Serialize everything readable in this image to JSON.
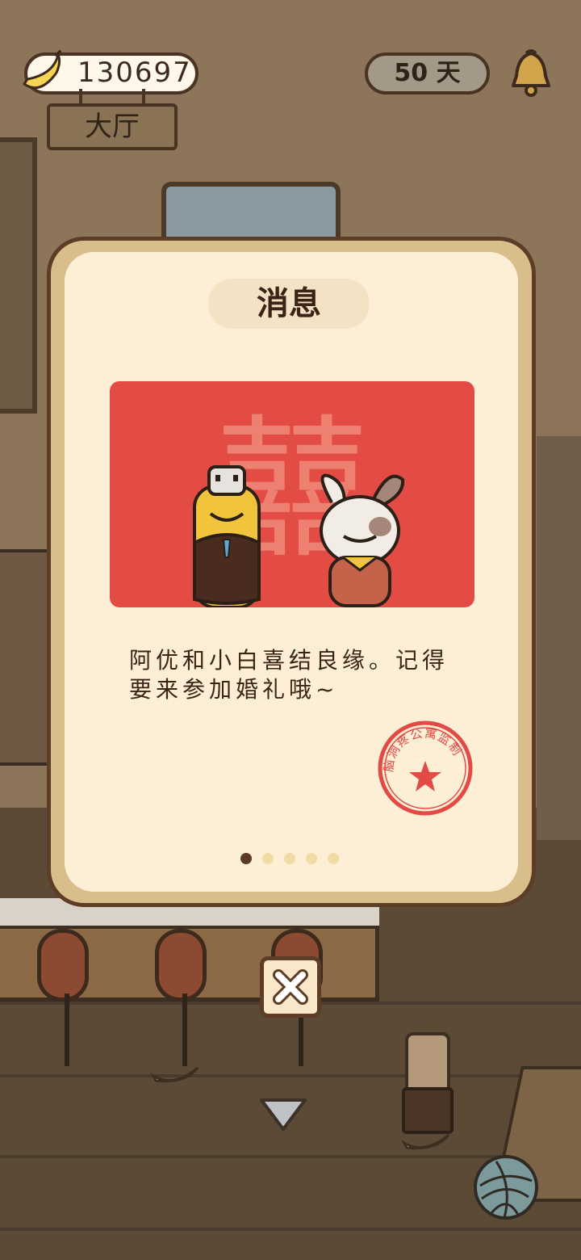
{
  "hud": {
    "banana_count": "130697",
    "room_name": "大厅",
    "days_label": "50 天"
  },
  "dialog": {
    "title": "消息",
    "banner_glyph": "囍",
    "message": "阿优和小白喜结良缘。记得要来参加婚礼哦~",
    "stamp_text": "脑洞疼公寓监制",
    "page_total": 5,
    "page_current": 1
  },
  "colors": {
    "banner_red": "#e34c44",
    "dialog_bg": "#fcefd6",
    "frame": "#d9bd8a",
    "stamp_red": "#e24b45"
  },
  "icons": {
    "currency": "banana-icon",
    "notifications": "bell-icon",
    "close": "close-icon",
    "scroll_down": "chevron-down-icon",
    "menu": "yarn-ball-icon"
  }
}
